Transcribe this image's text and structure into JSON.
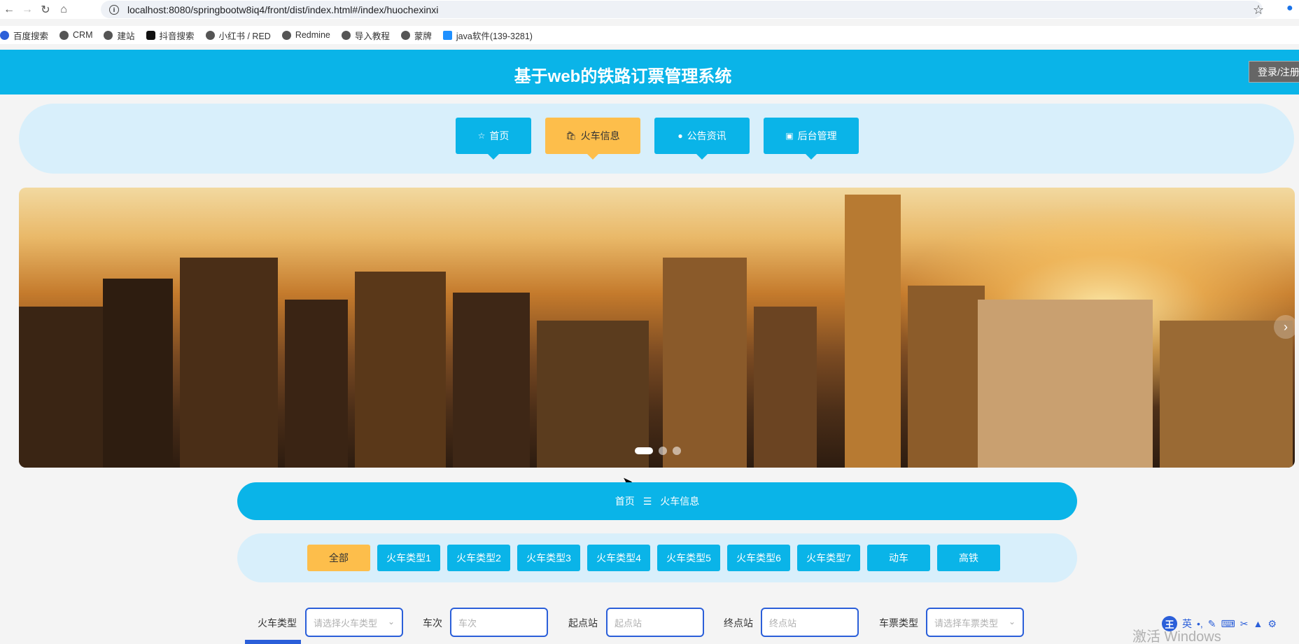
{
  "browser": {
    "url": "localhost:8080/springbootw8iq4/front/dist/index.html#/index/huochexinxi",
    "bookmarks": [
      "百度搜索",
      "CRM",
      "建站",
      "抖音搜索",
      "小红书 / RED",
      "Redmine",
      "导入教程",
      "蒙牌",
      "java软件(139-3281)"
    ]
  },
  "header": {
    "title": "基于web的铁路订票管理系统",
    "login_label": "登录/注册"
  },
  "nav": [
    {
      "label": "首页",
      "icon": "star-icon"
    },
    {
      "label": "火车信息",
      "icon": "bag-icon"
    },
    {
      "label": "公告资讯",
      "icon": "info-icon"
    },
    {
      "label": "后台管理",
      "icon": "briefcase-icon"
    }
  ],
  "banner": {
    "slides_count": 3,
    "active_slide": 1
  },
  "breadcrumb": {
    "home": "首页",
    "separator": "☰",
    "current": "火车信息"
  },
  "categories": [
    "全部",
    "火车类型1",
    "火车类型2",
    "火车类型3",
    "火车类型4",
    "火车类型5",
    "火车类型6",
    "火车类型7",
    "动车",
    "高铁"
  ],
  "filters": {
    "train_type_label": "火车类型",
    "train_type_placeholder": "请选择火车类型",
    "train_no_label": "车次",
    "train_no_placeholder": "车次",
    "start_label": "起点站",
    "start_placeholder": "起点站",
    "end_label": "终点站",
    "end_placeholder": "终点站",
    "ticket_type_label": "车票类型",
    "ticket_type_placeholder": "请选择车票类型"
  },
  "system": {
    "watermark": "激活 Windows",
    "ime_logo": "王",
    "ime_lang": "英"
  },
  "colors": {
    "primary": "#0ab4e8",
    "accent": "#fdbe4b",
    "nav_bg": "#d8effb",
    "input_border": "#2b5fd9"
  }
}
